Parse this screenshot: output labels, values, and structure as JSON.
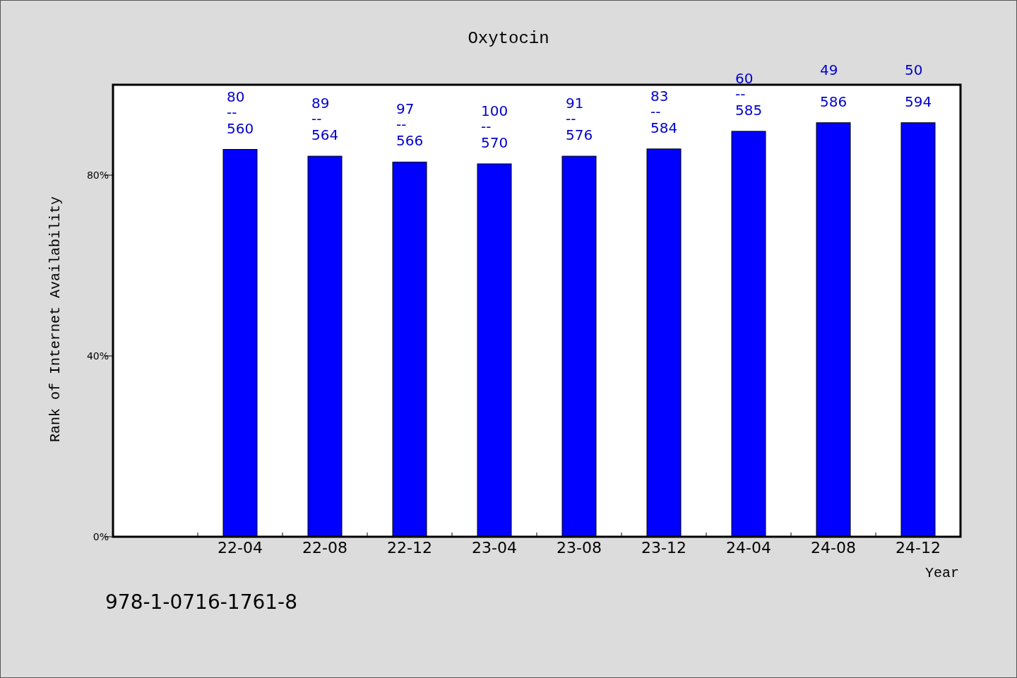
{
  "chart": {
    "chart_data": {
      "type": "bar",
      "title": "Oxytocin",
      "xlabel": "Year",
      "ylabel": "Rank of Internet Availability",
      "categories": [
        "22-04",
        "22-08",
        "22-12",
        "23-04",
        "23-08",
        "23-12",
        "24-04",
        "24-08",
        "24-12"
      ],
      "series": [
        {
          "color": "#0000ff",
          "values": [
            85.7,
            84.2,
            82.9,
            82.5,
            84.2,
            85.8,
            89.7,
            91.6,
            91.6
          ]
        }
      ],
      "ylim": [
        0,
        100
      ],
      "yticks": [
        {
          "value": 0,
          "label": "0%"
        },
        {
          "value": 40,
          "label": "40%"
        },
        {
          "value": 80,
          "label": "80%"
        }
      ],
      "value_labels": [
        [
          "80",
          "--",
          "560"
        ],
        [
          "89",
          "--",
          "564"
        ],
        [
          "97",
          "--",
          "566"
        ],
        [
          "100",
          "--",
          "570"
        ],
        [
          "91",
          "--",
          "576"
        ],
        [
          "83",
          "--",
          "584"
        ],
        [
          "60",
          "--",
          "585"
        ],
        [
          "49",
          null,
          "586"
        ],
        [
          "50",
          null,
          "594"
        ]
      ]
    }
  },
  "footer": {
    "code": "978-1-0716-1761-8"
  }
}
